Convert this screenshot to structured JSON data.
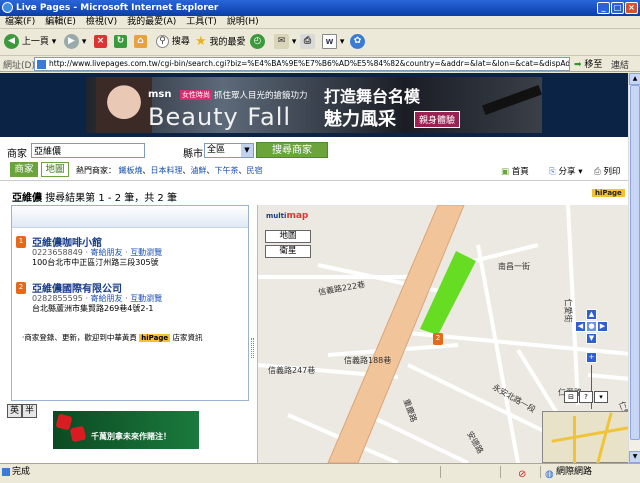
{
  "window": {
    "title": "Live Pages - Microsoft Internet Explorer",
    "min": "_",
    "max": "□",
    "close": "×"
  },
  "menu": [
    "檔案(F)",
    "編輯(E)",
    "檢視(V)",
    "我的最愛(A)",
    "工具(T)",
    "說明(H)"
  ],
  "toolbar": {
    "back": "上一頁",
    "search": "搜尋",
    "favorites": "我的最愛"
  },
  "address": {
    "label": "網址(D)",
    "url": "http://www.livepages.com.tw/cgi-bin/search.cgi?biz=%E4%BA%9E%E7%B6%AD%E5%84%82&country=&addr=&lat=&lon=&cat=&dispAddr=&dispCat=&p=",
    "go": "移至",
    "links": "連結"
  },
  "banner": {
    "msn": "msn",
    "tag": "女性時尚",
    "tag2": "抓住眾人目光的搶鏡功力",
    "main": "Beauty Fall",
    "line1": "打造舞台名模",
    "line2": "魅力風采",
    "cta": "親身體驗"
  },
  "search": {
    "business_label": "商家",
    "business_value": "亞維儂",
    "city_label": "縣市",
    "city_value": "全區",
    "button": "搜尋商家"
  },
  "tabs": [
    {
      "label": "商家",
      "active": true
    },
    {
      "label": "地圖",
      "active": false
    }
  ],
  "hot": {
    "label": "熱門商家：",
    "items": [
      "鐵板燒",
      "日本料理",
      "滷鮮",
      "下午茶",
      "民宿"
    ]
  },
  "tools": {
    "home": "首頁",
    "share": "分享",
    "print": "列印"
  },
  "results": {
    "query": "亞維儂",
    "summary": "搜尋結果第 1 - 2 筆，共 2 筆",
    "badge": "hiPage"
  },
  "listings": [
    {
      "pin": "1",
      "name": "亞維儂咖啡小館",
      "phone": "0223658849",
      "link1": "寄給朋友",
      "link2": "互動瀏覽",
      "address": "100台北市中正區汀州路三段305號"
    },
    {
      "pin": "2",
      "name": "亞維儂國際有限公司",
      "phone": "0282855595",
      "link1": "寄給朋友",
      "link2": "互動瀏覽",
      "address": "台北縣蘆洲市集賢路269巷4號2-1"
    }
  ],
  "promo": {
    "text": "‧商家登錄、更新，歡迎到中華黃頁",
    "badge": "hiPage",
    "tail": "店家資訊"
  },
  "map": {
    "logo_a": "multi",
    "logo_b": "map",
    "btn_map": "地圖",
    "btn_sat": "衛星",
    "labels": [
      "信義路222巷",
      "信義路247巷",
      "信義路188巷",
      "仁愛路",
      "永安北路一段",
      "重慶路",
      "安德路",
      "南昌一街",
      "仁愛路二段",
      "仁愛街"
    ],
    "pin": "2"
  },
  "lang": {
    "a": "英",
    "b": "半"
  },
  "ad2": {
    "text": "千萬別拿未來作賭注！"
  },
  "status": {
    "text": "完成",
    "zone": "網際網路"
  }
}
